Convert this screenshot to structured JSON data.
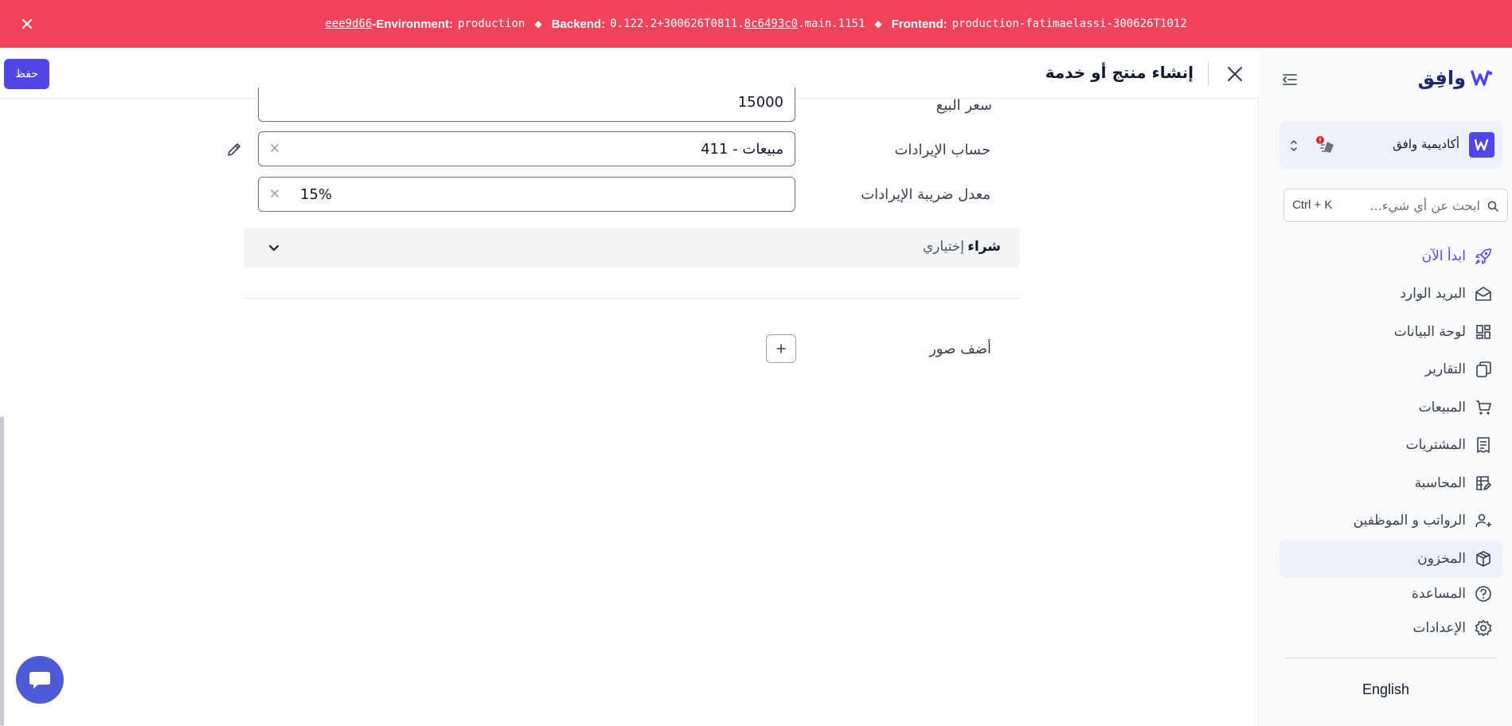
{
  "env": {
    "commit": "eee9d66",
    "env_label": "-Environment:",
    "env_value": "production",
    "backend_label": "Backend:",
    "backend_prefix": "0.122.2+300626T0811.",
    "backend_hash": "8c6493c0",
    "backend_suffix": ".main.1151",
    "frontend_label": "Frontend:",
    "frontend_value": "production-fatimaelassi-300626T1012",
    "separator": "◆",
    "color": "#f0435c"
  },
  "header": {
    "title": "إنشاء منتج أو خدمة",
    "save_label": "حفظ"
  },
  "form": {
    "sale_price": {
      "label": "سعر البيع",
      "value": "15000"
    },
    "revenue_account": {
      "label": "حساب الإيرادات",
      "value": "411 - مبيعات"
    },
    "revenue_tax": {
      "label": "معدل ضريبة الإيرادات",
      "value": "15%"
    },
    "purchase_section": {
      "title": "شراء",
      "subtitle": "إختياري"
    },
    "add_images_label": "أضف صور"
  },
  "sidebar": {
    "brand": "وافِق",
    "org_name": "أكاديمية وافق",
    "search_placeholder": "ابحث عن أي شيء...",
    "search_shortcut": "Ctrl + K",
    "items": [
      {
        "label": "ابدأ الآن",
        "icon": "rocket-icon"
      },
      {
        "label": "البريد الوارد",
        "icon": "inbox-icon"
      },
      {
        "label": "لوحة البيانات",
        "icon": "dashboard-icon"
      },
      {
        "label": "التقارير",
        "icon": "reports-icon"
      },
      {
        "label": "المبيعات",
        "icon": "cart-icon"
      },
      {
        "label": "المشتريات",
        "icon": "receipt-icon"
      },
      {
        "label": "المحاسبة",
        "icon": "accounting-icon"
      },
      {
        "label": "الرواتب و الموظفين",
        "icon": "employees-icon"
      },
      {
        "label": "المخزون",
        "icon": "box-icon"
      },
      {
        "label": "المساعدة",
        "icon": "help-icon"
      },
      {
        "label": "الإعدادات",
        "icon": "gear-icon"
      }
    ],
    "active_index": 8,
    "language_toggle": "English",
    "accent": "#4f46e5"
  }
}
